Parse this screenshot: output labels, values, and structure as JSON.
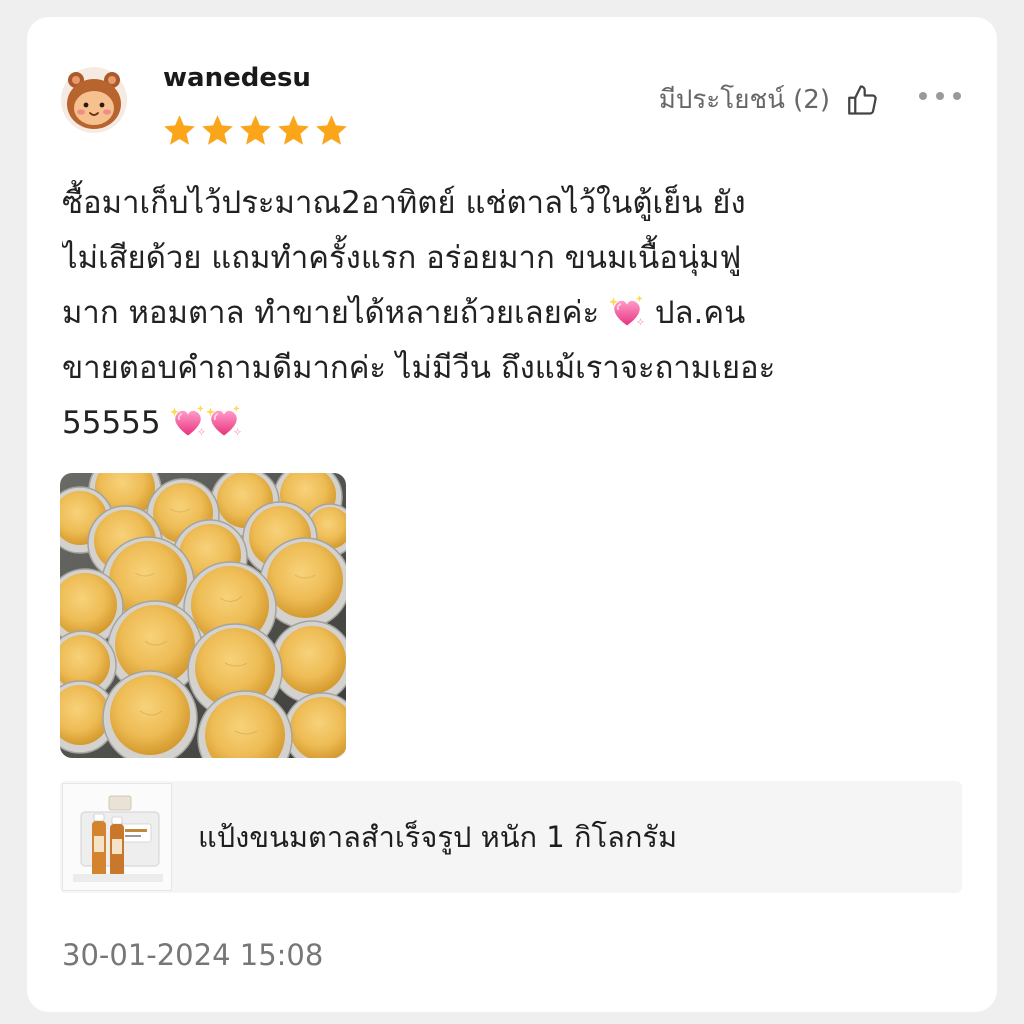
{
  "review": {
    "username": "wanedesu",
    "avatar_icon": "cartoon-avatar-icon",
    "rating": 5,
    "rating_max": 5,
    "helpful_label": "มีประโยชน์ (2)",
    "helpful_icon": "thumbs-up-icon",
    "more_icon": "more-dots-icon",
    "text_lines": [
      [
        {
          "text": "ซื้อมาเก็บไว้ประมาณ2อาทิตย์ แช่ตาลไว้ในตู้เย็น ยัง"
        }
      ],
      [
        {
          "text": "ไม่เสียด้วย แถมทำครั้งแรก อร่อยมาก ขนมเนื้อนุ่มฟู"
        }
      ],
      [
        {
          "text": "มาก หอมตาล ทำขายได้หลายถ้วยเลยค่ะ "
        },
        {
          "icon": "sparkling-heart-icon"
        },
        {
          "text": " ปล.คน"
        }
      ],
      [
        {
          "text": "ขายตอบคำถามดีมากค่ะ ไม่มีวีน ถึงแม้เราจะถามเยอะ"
        }
      ],
      [
        {
          "text": "55555 "
        },
        {
          "icon": "sparkling-heart-icon"
        },
        {
          "icon": "sparkling-heart-icon"
        }
      ]
    ],
    "timestamp": "30-01-2024 15:08"
  },
  "product": {
    "name": "แป้งขนมตาลสำเร็จรูป หนัก 1 กิโลกรัม"
  },
  "colors": {
    "page_bg": "#efefef",
    "card_bg": "#ffffff",
    "star": "#FBA51A",
    "text": "#222222",
    "muted": "#777777",
    "product_bg": "#f5f5f5",
    "heart": "#f0609e"
  }
}
